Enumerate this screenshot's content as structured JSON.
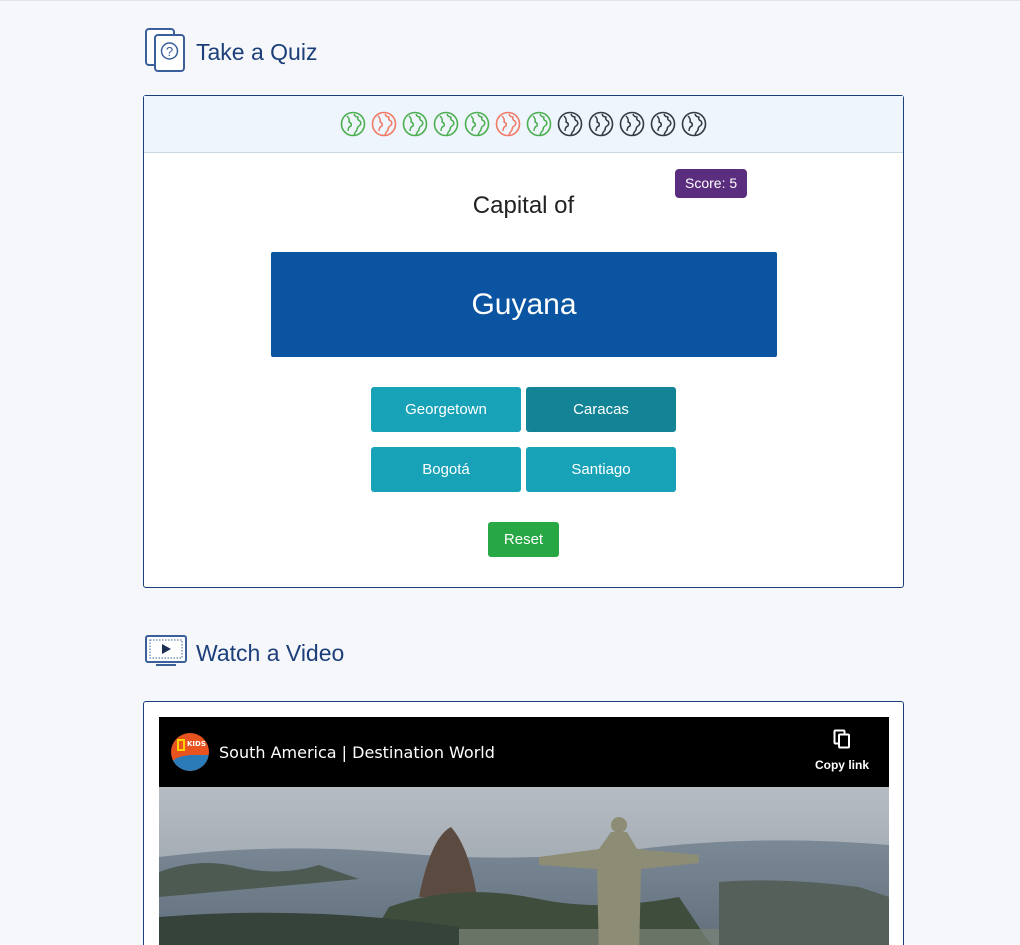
{
  "quiz_section": {
    "title": "Take a Quiz",
    "icon": "quiz-cards-icon"
  },
  "progress": {
    "icon": "globe-icon",
    "items": [
      "correct",
      "wrong",
      "correct",
      "correct",
      "correct",
      "wrong",
      "correct",
      "pending",
      "pending",
      "pending",
      "pending",
      "pending"
    ],
    "colors": {
      "correct": "#4caf50",
      "wrong": "#f07a66",
      "pending": "#343a40"
    }
  },
  "quiz": {
    "score_label": "Score: 5",
    "prompt": "Capital of",
    "country": "Guyana",
    "answers": [
      "Georgetown",
      "Caracas",
      "Bogotá",
      "Santiago"
    ],
    "reset_label": "Reset"
  },
  "video_section": {
    "title": "Watch a Video",
    "icon": "monitor-play-icon"
  },
  "video": {
    "title": "South America | Destination World",
    "copy_link_label": "Copy link",
    "channel_icon": "nat-geo-kids-logo"
  },
  "colors": {
    "heading": "#1c3f7a",
    "country_box": "#0b54a1",
    "answer": "#17a2b8",
    "score_badge": "#5b2d7e",
    "reset": "#28a745"
  }
}
